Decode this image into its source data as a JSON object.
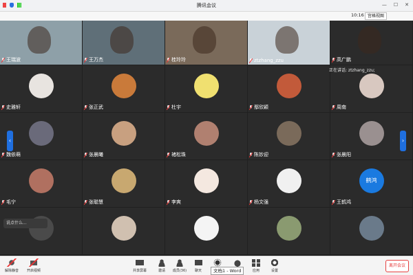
{
  "window": {
    "title": "腾讯会议"
  },
  "subbar": {
    "time": "10:16",
    "view_label": "宫格视图"
  },
  "top_row": [
    {
      "name": "王瑞波",
      "bg": "#8ea0a8"
    },
    {
      "name": "王万杰",
      "bg": "#5f6f78"
    },
    {
      "name": "桂玲玲",
      "bg": "#7a6a5a"
    },
    {
      "name": "ztzhang_zzu",
      "bg": "#c9d2d8"
    },
    {
      "name": "高广鹏",
      "bg": "#2b2b2b"
    }
  ],
  "speaking": "正在讲话: ztzhang_zzu;",
  "grid": [
    [
      {
        "name": "史雅轩",
        "c": "#e8e4e0"
      },
      {
        "name": "张正武",
        "c": "#c97a3a"
      },
      {
        "name": "杜宇",
        "c": "#f0e070"
      },
      {
        "name": "鄢欣颖",
        "c": "#c25a3a"
      },
      {
        "name": "周南",
        "c": "#d8c8c0"
      }
    ],
    [
      {
        "name": "魏依萌",
        "c": "#6a6a7a"
      },
      {
        "name": "张晨曦",
        "c": "#c8a080"
      },
      {
        "name": "褚松珠",
        "c": "#b08070"
      },
      {
        "name": "陈妙迎",
        "c": "#7a6a5a"
      },
      {
        "name": "张晨阳",
        "c": "#9a9090"
      }
    ],
    [
      {
        "name": "毛宁",
        "c": "#b07060"
      },
      {
        "name": "张聪慧",
        "c": "#c8a870"
      },
      {
        "name": "李爽",
        "c": "#f4e8e0"
      },
      {
        "name": "杨文强",
        "c": "#f0f0f0"
      },
      {
        "name": "王鹤鸿",
        "c": "#1a7ae0",
        "text": "鹤鸿"
      }
    ],
    [
      {
        "name": "",
        "c": "#4a4a4a"
      },
      {
        "name": "",
        "c": "#d0c0b0"
      },
      {
        "name": "",
        "c": "#f4f4f4"
      },
      {
        "name": "",
        "c": "#8a9a70"
      },
      {
        "name": "",
        "c": "#6a7a8a"
      }
    ]
  ],
  "chat_placeholder": "说点什么...",
  "toolbar": {
    "mute": "解除静音",
    "video": "开启视频",
    "share": "共享屏幕",
    "invite": "邀请",
    "members": "成员(36)",
    "chat": "聊天",
    "record": "录制",
    "raise": "举手",
    "apps": "应用",
    "settings": "设置",
    "leave": "离开会议"
  },
  "tooltip": "文档1 - Word"
}
